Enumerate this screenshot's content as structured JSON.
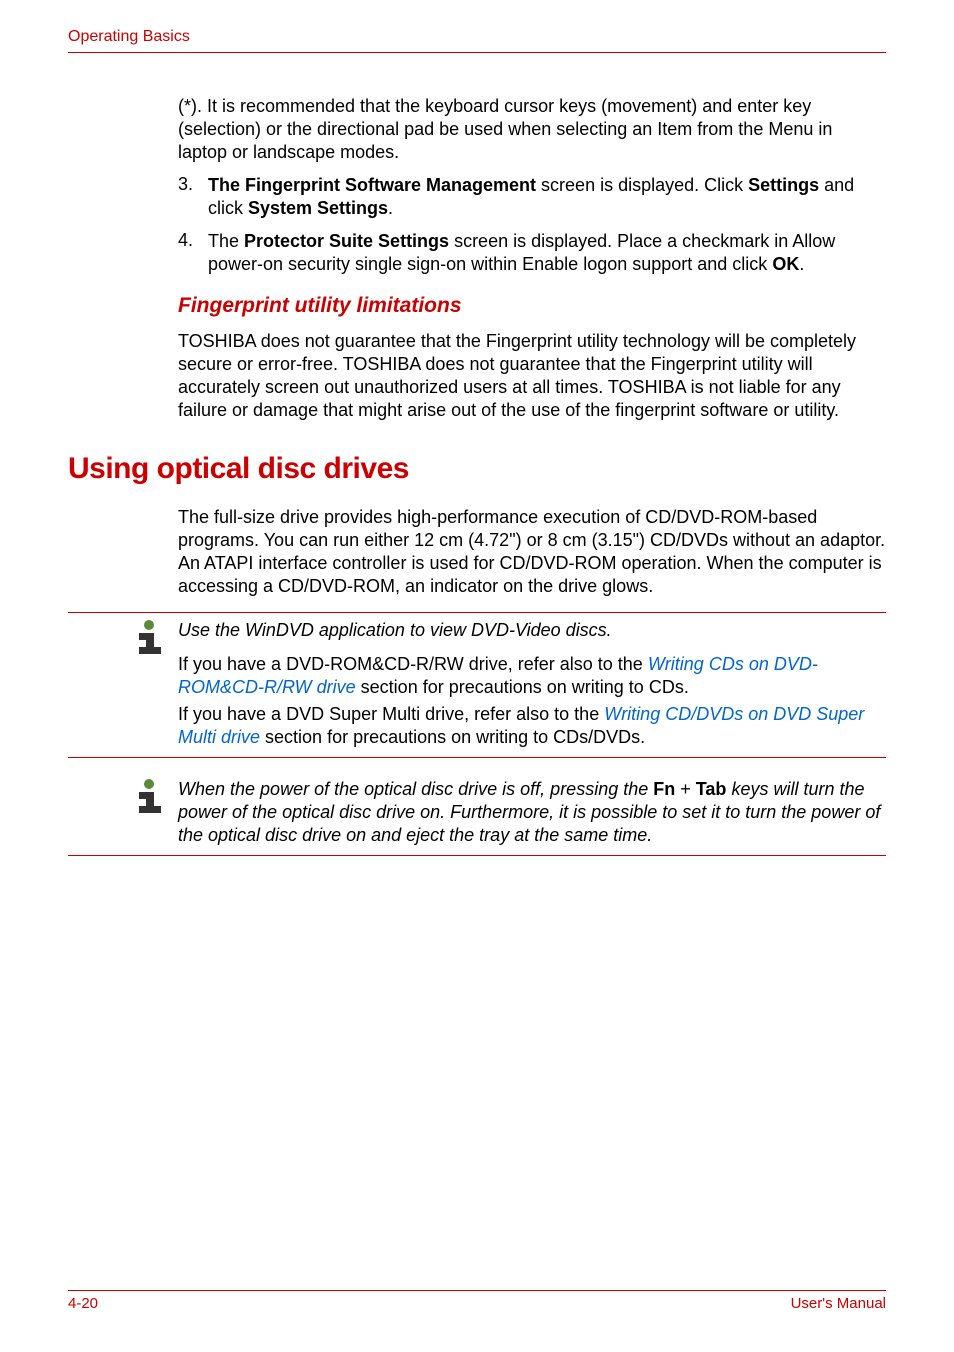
{
  "header": {
    "section": "Operating Basics"
  },
  "intro_paragraph": "(*). It is recommended that the keyboard cursor keys (movement) and enter key (selection) or the directional pad be used when selecting an Item from the Menu in laptop or landscape modes.",
  "list": {
    "item3": {
      "number": "3.",
      "before_bold1": "",
      "bold1": "The Fingerprint Software Management",
      "mid1": " screen is displayed. Click ",
      "bold2": "Settings",
      "mid2": " and click ",
      "bold3": "System Settings",
      "after": "."
    },
    "item4": {
      "number": "4.",
      "before1": "The ",
      "bold1": "Protector Suite Settings",
      "mid1": " screen is displayed. Place a checkmark in Allow power-on security single sign-on within Enable logon support and click ",
      "bold2": "OK",
      "after": "."
    }
  },
  "subsection": {
    "heading": "Fingerprint utility limitations",
    "text": "TOSHIBA does not guarantee that the Fingerprint utility technology will be completely secure or error-free. TOSHIBA does not guarantee that the Fingerprint utility will accurately screen out unauthorized users at all times. TOSHIBA is not liable for any failure or damage that might arise out of the use of the fingerprint software or utility."
  },
  "main": {
    "heading": "Using optical disc drives",
    "text": "The full-size drive provides high-performance execution of CD/DVD-ROM-based programs. You can run either 12 cm (4.72\") or 8 cm (3.15\") CD/DVDs without an adaptor. An ATAPI interface controller is used for CD/DVD-ROM operation. When the computer is accessing a CD/DVD-ROM, an indicator on the drive glows."
  },
  "note1": {
    "line1": "Use the WinDVD application to view DVD-Video discs.",
    "para2_before": "If you have a DVD-ROM&CD-R/RW drive, refer also to the ",
    "para2_link": "Writing CDs on DVD-ROM&CD-R/RW drive",
    "para2_after": " section for precautions on writing to CDs.",
    "para3_before": "If you have a DVD Super Multi drive, refer also to the ",
    "para3_link": "Writing CD/DVDs on DVD Super Multi drive",
    "para3_after": " section for precautions on writing to CDs/DVDs."
  },
  "note2": {
    "before1": "When the power of the optical disc drive is off, pressing the ",
    "bold1": "Fn",
    "mid1": " + ",
    "bold2": "Tab",
    "after": " keys will turn the power of the optical disc drive on. Furthermore, it is possible to set it to turn the power of the optical disc drive on and eject the tray at the same time."
  },
  "footer": {
    "page": "4-20",
    "label": "User's Manual"
  }
}
